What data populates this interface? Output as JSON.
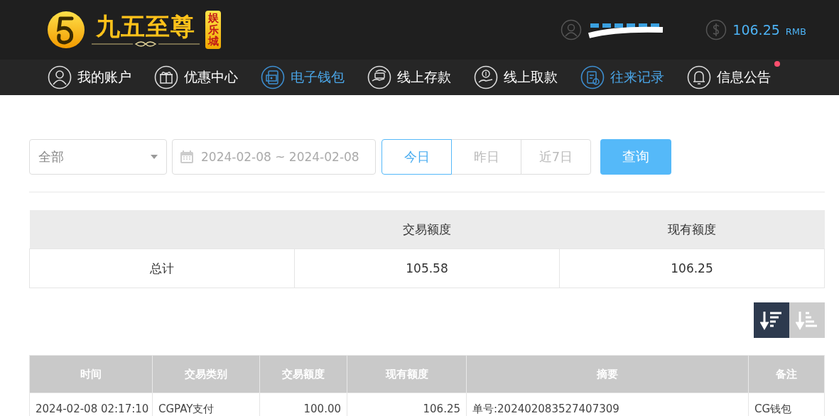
{
  "logo": {
    "title": "九五至尊",
    "badge": "娱乐城"
  },
  "account": {
    "balance": "106.25",
    "currency": "RMB"
  },
  "nav": [
    {
      "label": "我的账户",
      "kind": "user",
      "selected": false,
      "notice": false
    },
    {
      "label": "优惠中心",
      "kind": "gift",
      "selected": false,
      "notice": false
    },
    {
      "label": "电子钱包",
      "kind": "wallet",
      "selected": true,
      "notice": false
    },
    {
      "label": "线上存款",
      "kind": "deposit",
      "selected": false,
      "notice": false
    },
    {
      "label": "线上取款",
      "kind": "withdraw",
      "selected": false,
      "notice": false
    },
    {
      "label": "往来记录",
      "kind": "records",
      "selected": true,
      "notice": false
    },
    {
      "label": "信息公告",
      "kind": "bell",
      "selected": false,
      "notice": true
    }
  ],
  "filter": {
    "type_select": "全部",
    "date_range": "2024-02-08 ~ 2024-02-08",
    "ranges": [
      {
        "label": "今日",
        "selected": true
      },
      {
        "label": "昨日",
        "selected": false
      },
      {
        "label": "近7日",
        "selected": false
      }
    ],
    "query_button": "查询"
  },
  "summary": {
    "columns": [
      "",
      "交易额度",
      "现有额度"
    ],
    "row": [
      "总计",
      "105.58",
      "106.25"
    ]
  },
  "sort_buttons": [
    {
      "kind": "desc",
      "selected": true
    },
    {
      "kind": "asc",
      "selected": false
    }
  ],
  "table": {
    "columns": [
      "时间",
      "交易类别",
      "交易额度",
      "现有额度",
      "摘要",
      "备注"
    ],
    "rows": [
      [
        "2024-02-08 02:17:10",
        "CGPAY支付",
        "100.00",
        "106.25",
        "单号:202402083527407309",
        "CG钱包"
      ]
    ]
  }
}
